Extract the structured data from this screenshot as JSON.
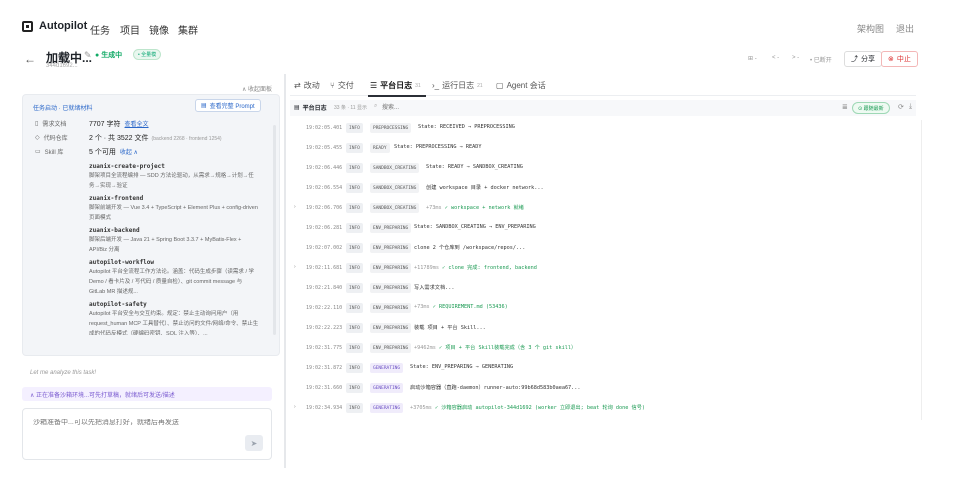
{
  "topnav": {
    "logo": "Autopilot",
    "links": [
      "任务",
      "项目",
      "镜像",
      "集群"
    ],
    "right": [
      "架构图",
      "退出"
    ]
  },
  "header": {
    "title": "加载中...",
    "subid": "344d1692...",
    "status": "生成中",
    "badge": "• 全量模",
    "controls": [
      "⊞ -",
      "< -",
      "> -",
      "• 已断开"
    ],
    "share": "分享",
    "stop": "中止"
  },
  "left": {
    "collapse": "∧ 收起面板",
    "card_title": "任务启动 · 已就绪材料",
    "view_prompt": "查看完整 Prompt",
    "req_label": "需求文档",
    "req_value": "7707 字符",
    "req_link": "查看全文",
    "repo_label": "代码仓库",
    "repo_value": "2 个 · 共 3522 文件",
    "repo_muted": "(backend 2268 · frontend 1254)",
    "skill_label": "Skill 库",
    "skill_value": "5 个可用",
    "skill_link": "收起 ∧",
    "skills": [
      {
        "name": "zuanix-create-project",
        "desc": "脚架项目全流程编排 — SDD 方法论驱动，从需求→规格→计划→任务→实现→验证"
      },
      {
        "name": "zuanix-frontend",
        "desc": "脚架前端开发 — Vue 3.4 + TypeScript + Element Plus + config-driven 页面模式"
      },
      {
        "name": "zuanix-backend",
        "desc": "脚架后端开发 — Java 21 + Spring Boot 3.3.7 + MyBatis-Flex + API/Biz 分离"
      },
      {
        "name": "autopilot-workflow",
        "desc": "Autopilot 平台全流程工作方法论。涵盖：代码生成步骤（读需求 / 学 Demo / 看卡片及 / 写代码 / 质量自检）、git commit message 与 GitLab MR 描述规..."
      },
      {
        "name": "autopilot-safety",
        "desc": "Autopilot 平台安全与交互约束。规定：禁止主动询问用户（用 request_human MCP 工具替代）、禁止访问的文件/网络/命令、禁止生成的代码反模式（硬编码密钥、SQL 注入等）、..."
      }
    ],
    "analyze": "Let me analyze this task!",
    "banner": "∧ 正在准备沙箱环境...可先打草稿，就绪后可发送/描述",
    "composer_placeholder": "沙箱准备中...可以先把消息打好，就绪后再发送"
  },
  "right": {
    "tabs": [
      {
        "label": "改动",
        "count": ""
      },
      {
        "label": "交付",
        "count": ""
      },
      {
        "label": "平台日志",
        "count": "31"
      },
      {
        "label": "运行日志",
        "count": "21"
      },
      {
        "label": "Agent 会话",
        "count": ""
      }
    ],
    "toolbar_title": "平台日志",
    "toolbar_count": "33 条 · 11 显示",
    "search_placeholder": "搜索...",
    "follow": "⊙ 跟随最新",
    "logs": [
      {
        "caret": "",
        "ts": "19:02:05.401",
        "lvl": "INFO",
        "phase": "PREPROCESSING",
        "dur": "",
        "msg": "State: RECEIVED → PREPROCESSING"
      },
      {
        "caret": "",
        "ts": "19:02:05.455",
        "lvl": "INFO",
        "phase": "READY",
        "dur": "",
        "msg": "State: PREPROCESSING → READY"
      },
      {
        "caret": "",
        "ts": "19:02:06.446",
        "lvl": "INFO",
        "phase": "SANDBOX_CREATING",
        "dur": "",
        "msg": "State: READY → SANDBOX_CREATING"
      },
      {
        "caret": "",
        "ts": "19:02:06.554",
        "lvl": "INFO",
        "phase": "SANDBOX_CREATING",
        "dur": "",
        "msg": "创建 workspace 目录 + docker network..."
      },
      {
        "caret": "›",
        "ts": "19:02:06.706",
        "lvl": "INFO",
        "phase": "SANDBOX_CREATING",
        "dur": "+73ms",
        "msg": "✓ workspace + network 就绪"
      },
      {
        "caret": "",
        "ts": "19:02:06.281",
        "lvl": "INFO",
        "phase": "ENV_PREPARING",
        "dur": "",
        "msg": "State: SANDBOX_CREATING → ENV_PREPARING"
      },
      {
        "caret": "",
        "ts": "19:02:07.002",
        "lvl": "INFO",
        "phase": "ENV_PREPARING",
        "dur": "",
        "msg": "clone 2 个仓库到 /workspace/repos/..."
      },
      {
        "caret": "›",
        "ts": "19:02:11.681",
        "lvl": "INFO",
        "phase": "ENV_PREPARING",
        "dur": "+11789ms",
        "msg": "✓ clone 完成: frontend, backend"
      },
      {
        "caret": "",
        "ts": "19:02:21.840",
        "lvl": "INFO",
        "phase": "ENV_PREPARING",
        "dur": "",
        "msg": "写入需求文档..."
      },
      {
        "caret": "",
        "ts": "19:02:22.110",
        "lvl": "INFO",
        "phase": "ENV_PREPARING",
        "dur": "+73ms",
        "msg": "✓ REQUIREMENT.md (53436)"
      },
      {
        "caret": "",
        "ts": "19:02:22.223",
        "lvl": "INFO",
        "phase": "ENV_PREPARING",
        "dur": "",
        "msg": "装载 项目 + 平台 Skill..."
      },
      {
        "caret": "",
        "ts": "19:02:31.775",
        "lvl": "INFO",
        "phase": "ENV_PREPARING",
        "dur": "+9462ms",
        "msg": "✓ 项目 + 平台 Skill装载完成（含 3 个 git skill）"
      },
      {
        "caret": "",
        "ts": "19:02:31.872",
        "lvl": "INFO",
        "phase": "GENERATING",
        "dur": "",
        "msg": "State: ENV_PREPARING → GENERATING"
      },
      {
        "caret": "",
        "ts": "19:02:31.660",
        "lvl": "INFO",
        "phase": "GENERATING",
        "dur": "",
        "msg": "启动沙箱容器（直跑-daemon）runner-auto:99b68d583b0aea67..."
      },
      {
        "caret": "›",
        "ts": "19:02:34.934",
        "lvl": "INFO",
        "phase": "GENERATING",
        "dur": "+3705ms",
        "msg": "✓ 沙箱容器启动 autopilot-344d1692 (worker 立即退出; beat 轮询 done 信号)"
      }
    ]
  }
}
